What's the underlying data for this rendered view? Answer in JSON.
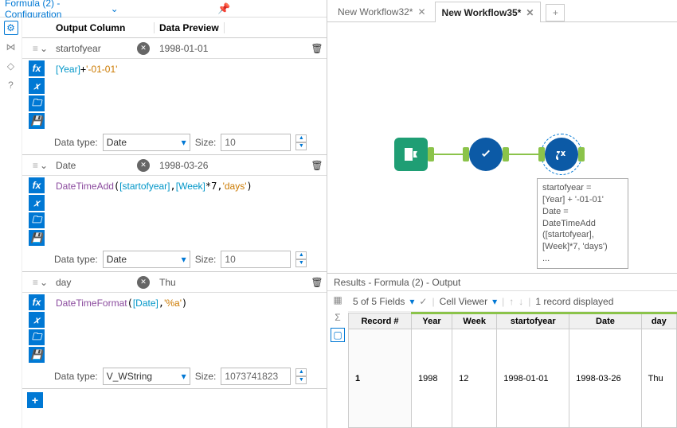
{
  "config": {
    "title": "Formula (2) - Configuration",
    "headers": {
      "output_col": "Output Column",
      "data_preview": "Data Preview"
    },
    "formulas": [
      {
        "name": "startofyear",
        "preview": "1998-01-01",
        "expr": [
          {
            "t": "field",
            "v": "[Year]"
          },
          {
            "t": "plain",
            "v": "+"
          },
          {
            "t": "str",
            "v": "'-01-01'"
          }
        ],
        "data_type": "Date",
        "size": "10"
      },
      {
        "name": "Date",
        "preview": "1998-03-26",
        "expr": [
          {
            "t": "kw",
            "v": "DateTimeAdd"
          },
          {
            "t": "plain",
            "v": "("
          },
          {
            "t": "field",
            "v": "[startofyear]"
          },
          {
            "t": "plain",
            "v": ","
          },
          {
            "t": "field",
            "v": "[Week]"
          },
          {
            "t": "plain",
            "v": "*7,"
          },
          {
            "t": "str",
            "v": "'days'"
          },
          {
            "t": "plain",
            "v": ")"
          }
        ],
        "data_type": "Date",
        "size": "10"
      },
      {
        "name": "day",
        "preview": "Thu",
        "expr": [
          {
            "t": "kw",
            "v": "DateTimeFormat"
          },
          {
            "t": "plain",
            "v": "("
          },
          {
            "t": "field",
            "v": "[Date]"
          },
          {
            "t": "plain",
            "v": ","
          },
          {
            "t": "str",
            "v": "'%a'"
          },
          {
            "t": "plain",
            "v": ")"
          }
        ],
        "data_type": "V_WString",
        "size": "1073741823"
      }
    ],
    "labels": {
      "data_type": "Data type:",
      "size": "Size:"
    }
  },
  "tabs": [
    {
      "label": "New Workflow32*",
      "active": false
    },
    {
      "label": "New Workflow35*",
      "active": true
    }
  ],
  "tooltip_lines": [
    "startofyear =",
    "[Year] + '-01-01'",
    "Date =",
    "DateTimeAdd",
    "([startofyear],",
    "[Week]*7, 'days')",
    "..."
  ],
  "results": {
    "title": "Results - Formula (2) - Output",
    "toolbar": {
      "fields": "5 of 5 Fields",
      "cell_viewer": "Cell Viewer",
      "records": "1 record displayed"
    },
    "columns": [
      "Record #",
      "Year",
      "Week",
      "startofyear",
      "Date",
      "day"
    ],
    "row": [
      "1",
      "1998",
      "12",
      "1998-01-01",
      "1998-03-26",
      "Thu"
    ]
  },
  "chart_data": {
    "type": "table",
    "title": "Results - Formula (2) - Output",
    "columns": [
      "Record #",
      "Year",
      "Week",
      "startofyear",
      "Date",
      "day"
    ],
    "rows": [
      [
        "1",
        "1998",
        "12",
        "1998-01-01",
        "1998-03-26",
        "Thu"
      ]
    ]
  }
}
